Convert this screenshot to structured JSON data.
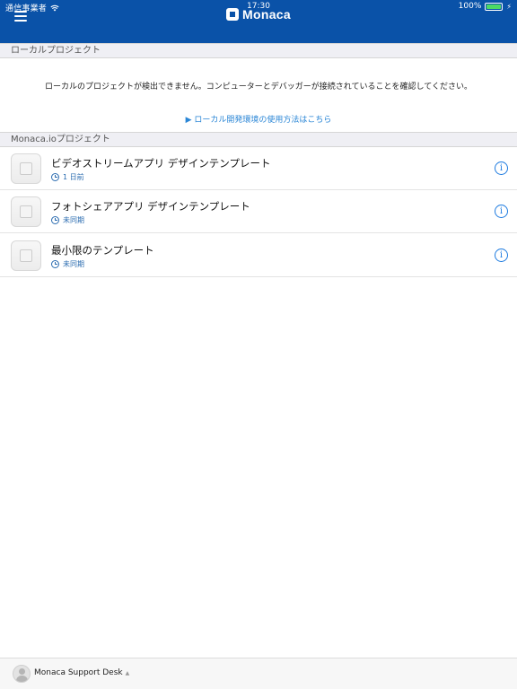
{
  "status_bar": {
    "carrier": "通信事業者",
    "time": "17:30",
    "battery": "100%",
    "battery_level": 1.0,
    "wifi_icon": "wifi-icon"
  },
  "header": {
    "app_name": "Monaca",
    "menu_icon": "hamburger-icon",
    "background": "#0a52a8"
  },
  "local_section": {
    "title": "ローカルプロジェクト",
    "message": "ローカルのプロジェクトが検出できません。コンピューターとデバッガーが接続されていることを確認してください。",
    "link": "▶ ローカル開発環境の使用方法はこちら"
  },
  "cloud_section": {
    "title": "Monaca.ioプロジェクト",
    "projects": [
      {
        "name": "ビデオストリームアプリ デザインテンプレート",
        "sync": "1 日前"
      },
      {
        "name": "フォトシェアアプリ デザインテンプレート",
        "sync": "未同期"
      },
      {
        "name": "最小限のテンプレート",
        "sync": "未同期"
      }
    ]
  },
  "footer": {
    "support_label": "Monaca Support Desk",
    "caret": "▲"
  },
  "colors": {
    "accent": "#0a52a8",
    "link": "#2a86d6",
    "info": "#1e7be0"
  }
}
